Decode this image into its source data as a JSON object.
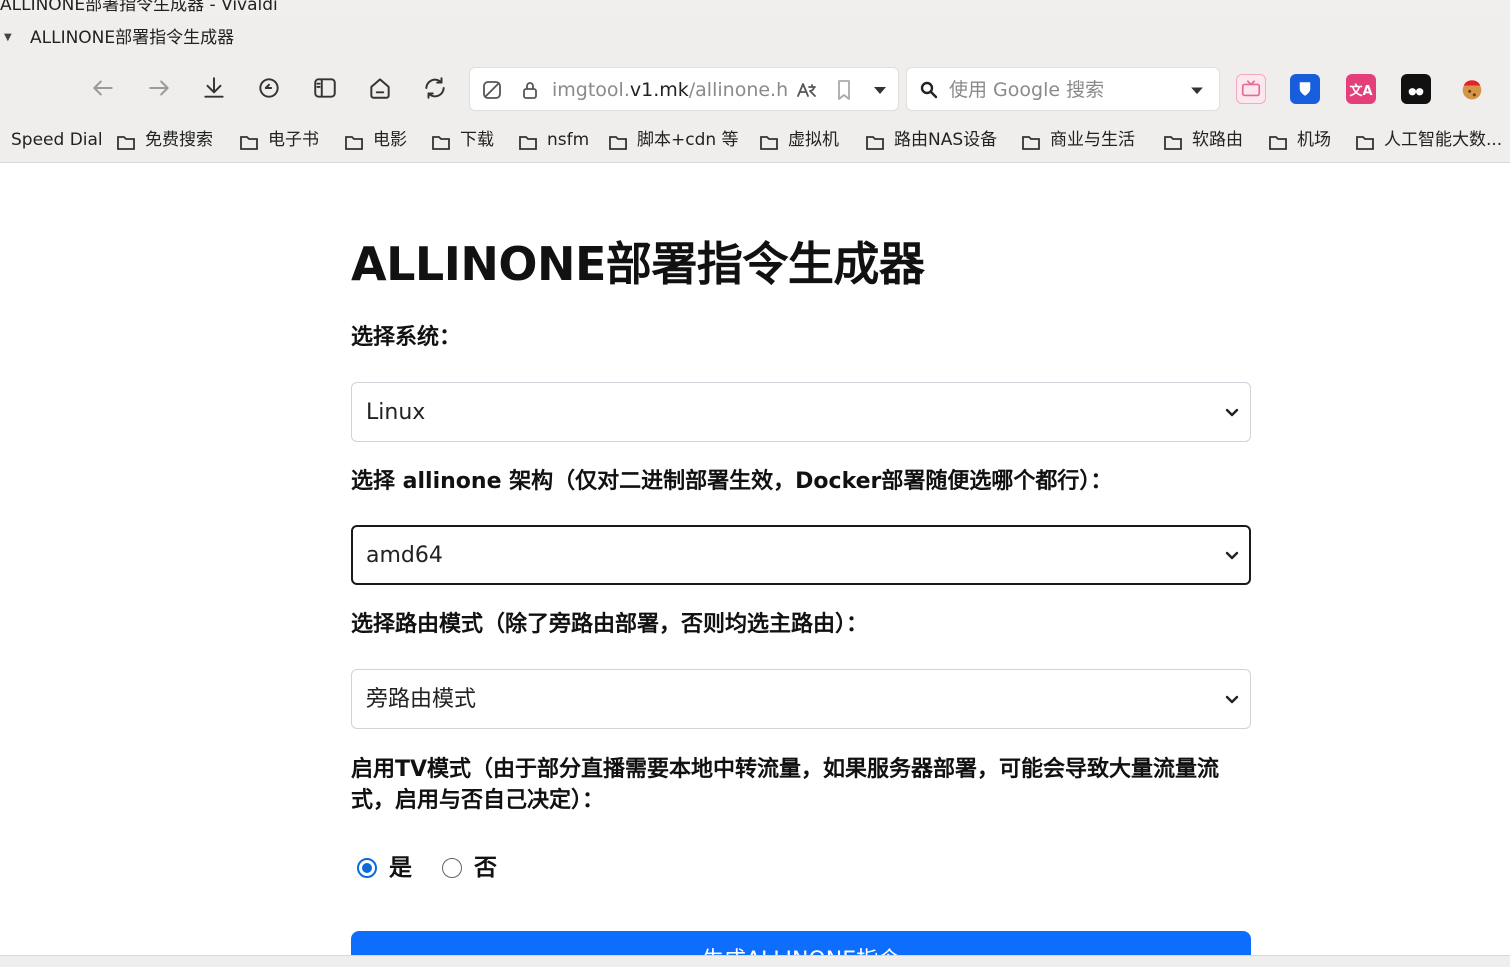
{
  "window": {
    "title": "ALLINONE部署指令生成器 - Vivaldi"
  },
  "tab": {
    "label": "ALLINONE部署指令生成器"
  },
  "address_bar": {
    "url_prefix": "imgtool.",
    "url_domain": "v1.mk",
    "url_path": "/allinone.ht..."
  },
  "search": {
    "placeholder": "使用 Google 搜索"
  },
  "extensions": [
    "tv-icon",
    "bitwarden-icon",
    "translate-icon",
    "tampermonkey-icon",
    "cookie-icon"
  ],
  "bookmarks": [
    "Speed Dial",
    "免费搜索",
    "电子书",
    "电影",
    "下载",
    "nsfm",
    "脚本+cdn 等",
    "虚拟机",
    "路由NAS设备",
    "商业与生活",
    "软路由",
    "机场",
    "人工智能大数..."
  ],
  "page": {
    "title": "ALLINONE部署指令生成器",
    "system": {
      "label": "选择系统：",
      "value": "Linux"
    },
    "arch": {
      "label": "选择 allinone 架构（仅对二进制部署生效，Docker部署随便选哪个都行）：",
      "value": "amd64"
    },
    "route": {
      "label": "选择路由模式（除了旁路由部署，否则均选主路由）：",
      "value": "旁路由模式"
    },
    "tv": {
      "label": "启用TV模式（由于部分直播需要本地中转流量，如果服务器部署，可能会导致大量流量流式，启用与否自己决定）：",
      "options": [
        "是",
        "否"
      ],
      "selected": "是"
    },
    "generate_button": "生成ALLINONE指令"
  },
  "colors": {
    "accent": "#0d6efd",
    "radio": "#0b6bd8",
    "chrome": "#efeeec"
  }
}
